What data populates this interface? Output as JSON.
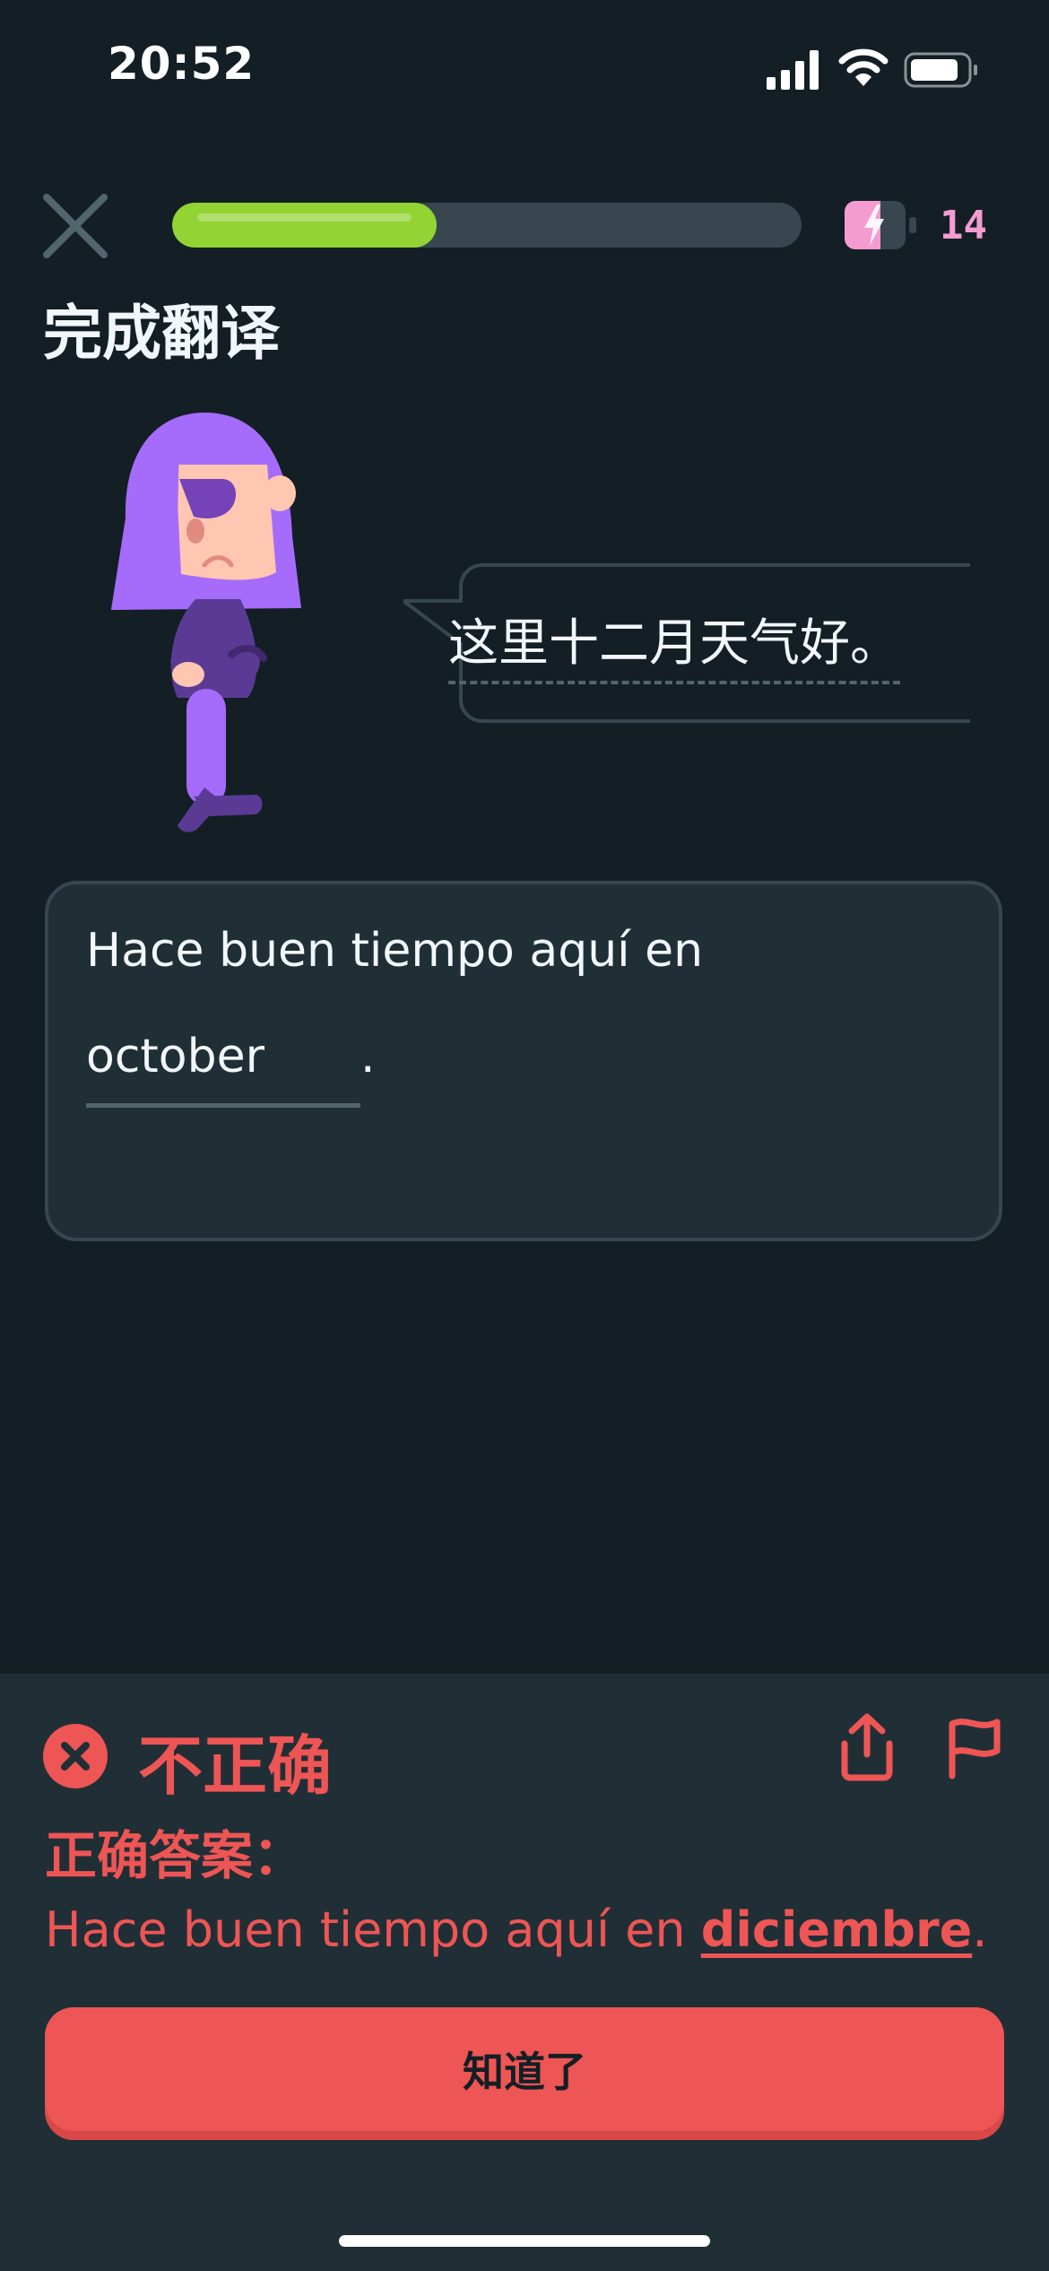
{
  "status_bar": {
    "time": "20:52",
    "icons": [
      "signal-icon",
      "wifi-icon",
      "battery-icon"
    ]
  },
  "lesson_header": {
    "close_icon": "close-icon",
    "progress_fraction": 0.42,
    "energy_icon": "energy-icon",
    "energy_count": "14"
  },
  "prompt": {
    "instruction": "完成翻译",
    "source_sentence": "这里十二月天气好。"
  },
  "answer": {
    "prefix": "Hace buen tiempo aquí en",
    "input_value": "october",
    "suffix": "."
  },
  "feedback": {
    "status_icon": "incorrect-x-icon",
    "title": "不正确",
    "share_icon": "share-icon",
    "flag_icon": "flag-icon",
    "correct_label": "正确答案：",
    "correct_prefix": "Hace buen tiempo aquí en ",
    "correct_word": "diciembre",
    "correct_suffix": ".",
    "continue_label": "知道了"
  },
  "colors": {
    "background": "#131f24",
    "progress": "#93d333",
    "error": "#ee5555",
    "energy": "#f49bd1"
  }
}
